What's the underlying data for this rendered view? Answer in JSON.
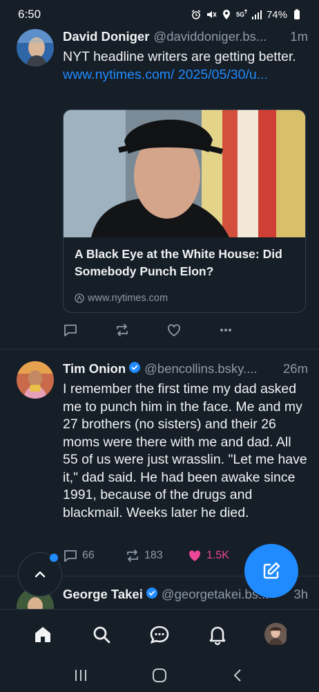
{
  "status_bar": {
    "time": "6:50",
    "battery": "74%",
    "icons": [
      "alarm-icon",
      "mute-icon",
      "location-icon",
      "5g-icon",
      "signal-icon",
      "battery-icon"
    ]
  },
  "posts": [
    {
      "name": "David Doniger",
      "handle": "@daviddoniger.bs...",
      "time": "1m",
      "text": "NYT headline writers are getting better.",
      "link": "www.nytimes.com/ 2025/05/30/u...",
      "embed": {
        "title": "A Black Eye at the White House: Did Somebody Punch Elon?",
        "domain": "www.nytimes.com"
      },
      "actions": {
        "reply": "",
        "repost": "",
        "like": ""
      }
    },
    {
      "name": "Tim Onion",
      "handle": "@bencollins.bsky....",
      "time": "26m",
      "verified": true,
      "text": "I remember the first time my dad asked me to punch him in the face. Me and my 27 brothers (no sisters) and their 26 moms were there with me and dad. All 55 of us were just wrasslin. \"Let me have it,\" dad said. He had been awake since 1991, because of the drugs and blackmail. Weeks later he died.",
      "actions": {
        "reply": "66",
        "repost": "183",
        "like": "1.5K"
      }
    },
    {
      "name": "George Takei",
      "handle": "@georgetakei.bs...",
      "time": "3h",
      "verified": true
    }
  ],
  "colors": {
    "background": "#161e27",
    "accent": "#208bfe",
    "like": "#ec4899",
    "muted": "#8f9bab"
  },
  "nav": [
    "home-icon",
    "search-icon",
    "chat-icon",
    "notifications-icon",
    "profile-avatar"
  ]
}
